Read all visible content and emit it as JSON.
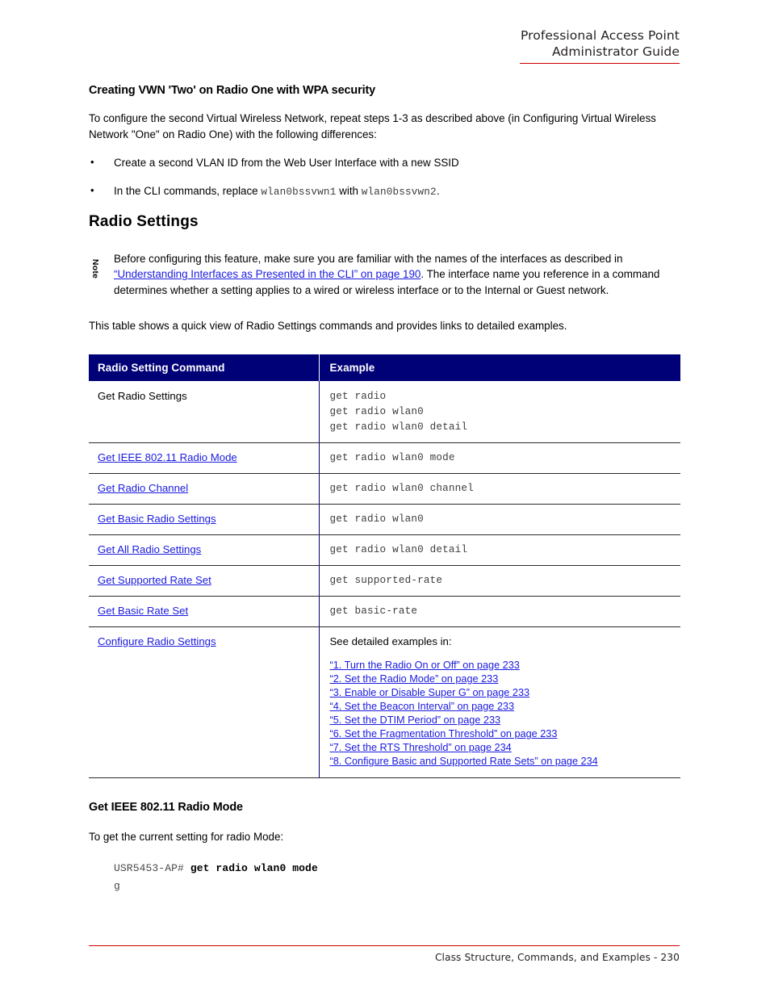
{
  "header": {
    "line1": "Professional Access Point",
    "line2": "Administrator Guide",
    "rule_color": "#cc0000"
  },
  "subsection": {
    "heading": "Creating VWN 'Two' on Radio One with WPA security",
    "intro": "To configure the second Virtual Wireless Network, repeat steps 1-3 as described above (in Configuring Virtual Wireless Network \"One\" on Radio One) with the following differences:",
    "bullets": [
      {
        "text_before": "Create a second VLAN ID from the Web User Interface with a new SSID",
        "code1": "",
        "text_mid": "",
        "code2": "",
        "text_after": ""
      },
      {
        "text_before": "In the CLI commands, replace ",
        "code1": "wlan0bssvwn1",
        "text_mid": " with ",
        "code2": "wlan0bssvwn2",
        "text_after": "."
      }
    ]
  },
  "section": {
    "heading": "Radio Settings",
    "note": {
      "label": "Note",
      "part1": "Before configuring this feature, make sure you are familiar with the names of the interfaces as described in ",
      "link": "“Understanding Interfaces as Presented in the CLI” on page 190",
      "part2": ". The interface name you reference in a command determines whether a setting applies to a wired or wireless interface or to the Internal or Guest network."
    },
    "table_intro": "This table shows a quick view of Radio Settings commands and provides links to detailed examples."
  },
  "table": {
    "header_bg": "#000077",
    "columns": [
      "Radio Setting Command",
      "Example"
    ],
    "rows": [
      {
        "command": "Get Radio Settings",
        "command_is_link": false,
        "example_lines": [
          "get radio",
          "get radio wlan0",
          "get radio wlan0 detail"
        ]
      },
      {
        "command": "Get IEEE 802.11 Radio Mode",
        "command_is_link": true,
        "example_lines": [
          "get radio wlan0 mode"
        ]
      },
      {
        "command": "Get Radio Channel",
        "command_is_link": true,
        "example_lines": [
          "get radio wlan0 channel"
        ]
      },
      {
        "command": "Get Basic Radio Settings",
        "command_is_link": true,
        "example_lines": [
          "get radio wlan0"
        ]
      },
      {
        "command": "Get All Radio Settings",
        "command_is_link": true,
        "example_lines": [
          "get radio wlan0 detail"
        ]
      },
      {
        "command": "Get Supported Rate Set",
        "command_is_link": true,
        "example_lines": [
          "get supported-rate"
        ]
      },
      {
        "command": "Get Basic Rate Set",
        "command_is_link": true,
        "example_lines": [
          "get basic-rate"
        ]
      }
    ],
    "last_row": {
      "command": "Configure Radio Settings",
      "command_is_link": true,
      "lead": "See detailed examples in:",
      "links": [
        "“1. Turn the Radio On or Off” on page 233",
        "“2. Set the Radio Mode” on page 233",
        "“3. Enable or Disable Super G” on page 233",
        "“4. Set the Beacon Interval” on page 233",
        "“5. Set the DTIM Period” on page 233",
        "“6. Set the Fragmentation Threshold” on page 233",
        "“7. Set the RTS Threshold” on page 234",
        "“8. Configure Basic and Supported Rate Sets” on page 234"
      ]
    }
  },
  "cli_example": {
    "heading": "Get IEEE 802.11 Radio Mode",
    "intro": "To get the current setting for radio Mode:",
    "prompt": "USR5453-AP#",
    "command": "get radio wlan0 mode",
    "output": "g"
  },
  "footer": {
    "text": "Class Structure, Commands, and Examples - 230",
    "rule_color": "#cc0000"
  },
  "link_color": "#1a1ae0"
}
